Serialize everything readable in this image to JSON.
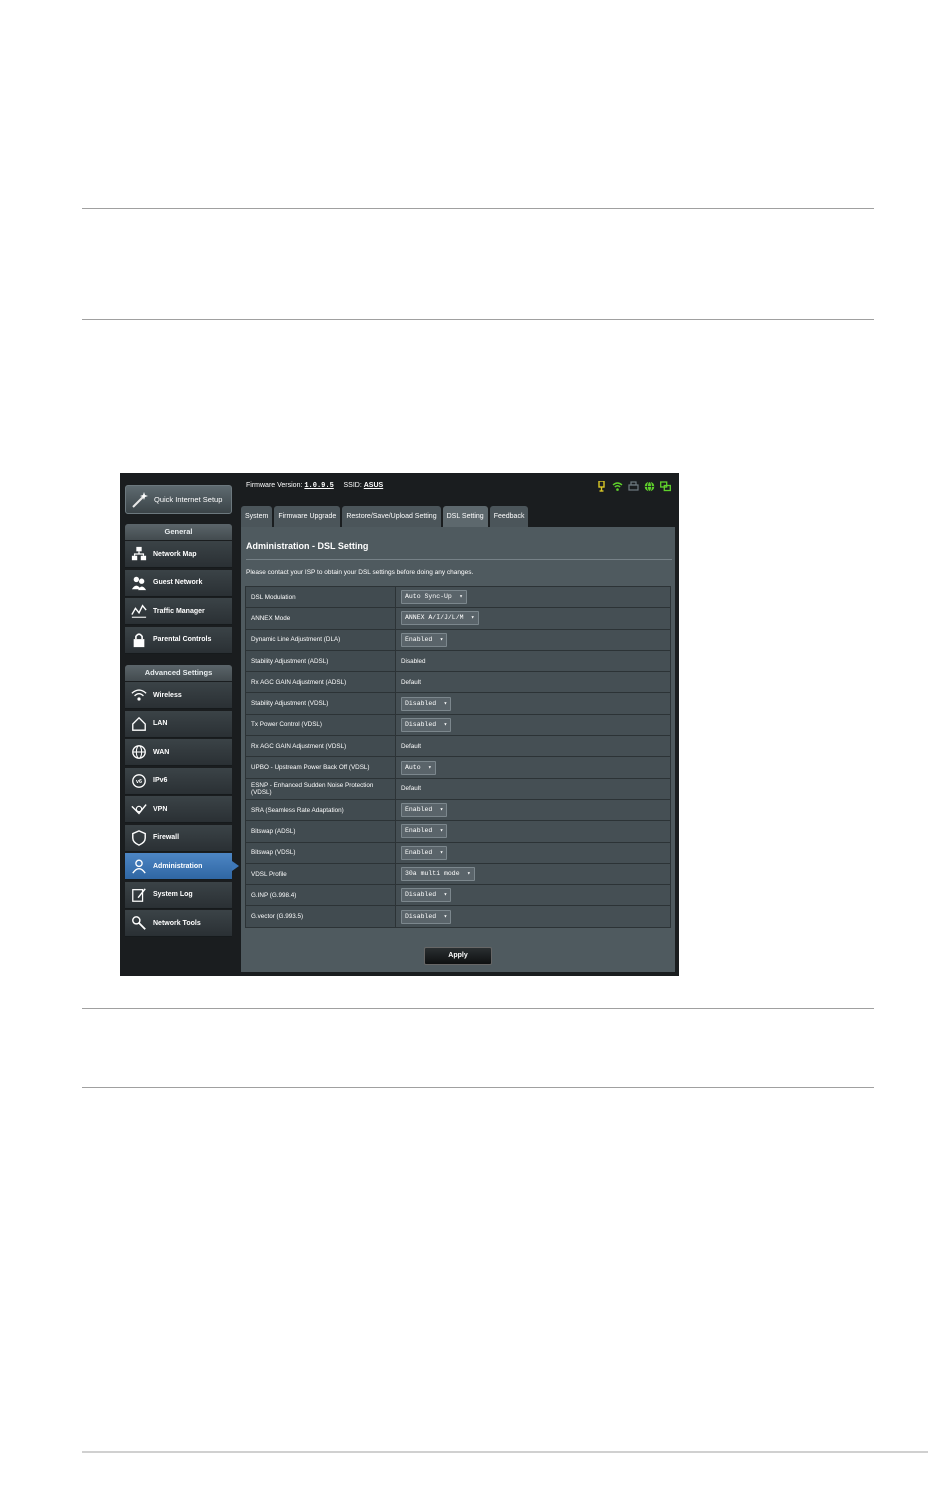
{
  "header": {
    "firmware_label": "Firmware Version:",
    "firmware_version": "1.0.9.5",
    "ssid_label": "SSID:",
    "ssid_value": "ASUS"
  },
  "sidebar": {
    "quick_setup": "Quick Internet Setup",
    "general_title": "General",
    "general_items": [
      {
        "label": "Network Map",
        "icon": "network-map-icon"
      },
      {
        "label": "Guest Network",
        "icon": "guest-network-icon"
      },
      {
        "label": "Traffic Manager",
        "icon": "traffic-manager-icon"
      },
      {
        "label": "Parental Controls",
        "icon": "lock-icon"
      }
    ],
    "advanced_title": "Advanced Settings",
    "advanced_items": [
      {
        "label": "Wireless",
        "icon": "wireless-icon"
      },
      {
        "label": "LAN",
        "icon": "home-icon"
      },
      {
        "label": "WAN",
        "icon": "globe-icon"
      },
      {
        "label": "IPv6",
        "icon": "ipv6-icon"
      },
      {
        "label": "VPN",
        "icon": "vpn-icon"
      },
      {
        "label": "Firewall",
        "icon": "shield-icon"
      },
      {
        "label": "Administration",
        "icon": "admin-user-icon"
      },
      {
        "label": "System Log",
        "icon": "log-icon"
      },
      {
        "label": "Network Tools",
        "icon": "tools-icon"
      }
    ],
    "active_item": "Administration"
  },
  "tabs": [
    "System",
    "Firmware Upgrade",
    "Restore/Save/Upload Setting",
    "DSL Setting",
    "Feedback"
  ],
  "active_tab": "DSL Setting",
  "page": {
    "title": "Administration - DSL Setting",
    "note": "Please contact your ISP to obtain your DSL settings before doing any changes.",
    "rows": [
      {
        "label": "DSL Modulation",
        "value": "Auto Sync-Up",
        "type": "select"
      },
      {
        "label": "ANNEX Mode",
        "value": "ANNEX A/I/J/L/M",
        "type": "select"
      },
      {
        "label": "Dynamic Line Adjustment (DLA)",
        "value": "Enabled",
        "type": "select"
      },
      {
        "label": "Stability Adjustment (ADSL)",
        "value": "Disabled",
        "type": "text"
      },
      {
        "label": "Rx AGC GAIN Adjustment (ADSL)",
        "value": "Default",
        "type": "text"
      },
      {
        "label": "Stability Adjustment (VDSL)",
        "value": "Disabled",
        "type": "select"
      },
      {
        "label": "Tx Power Control (VDSL)",
        "value": "Disabled",
        "type": "select"
      },
      {
        "label": "Rx AGC GAIN Adjustment (VDSL)",
        "value": "Default",
        "type": "text"
      },
      {
        "label": "UPBO - Upstream Power Back Off (VDSL)",
        "value": "Auto",
        "type": "select"
      },
      {
        "label": "ESNP - Enhanced Sudden Noise Protection (VDSL)",
        "value": "Default",
        "type": "text"
      },
      {
        "label": "SRA (Seamless Rate Adaptation)",
        "value": "Enabled",
        "type": "select"
      },
      {
        "label": "Bitswap (ADSL)",
        "value": "Enabled",
        "type": "select"
      },
      {
        "label": "Bitswap (VDSL)",
        "value": "Enabled",
        "type": "select"
      },
      {
        "label": "VDSL Profile",
        "value": "30a multi mode",
        "type": "select"
      },
      {
        "label": "G.INP (G.998.4)",
        "value": "Disabled",
        "type": "select"
      },
      {
        "label": "G.vector (G.993.5)",
        "value": "Disabled",
        "type": "select"
      }
    ],
    "apply_label": "Apply"
  },
  "status_icons": [
    "usb-icon",
    "wifi-status-icon",
    "printer-icon",
    "internet-status-icon",
    "lan-status-icon"
  ],
  "colors": {
    "active_nav": "#3d77b8",
    "status_green": "#5fd12b",
    "usb_yellow": "#d9c826"
  }
}
